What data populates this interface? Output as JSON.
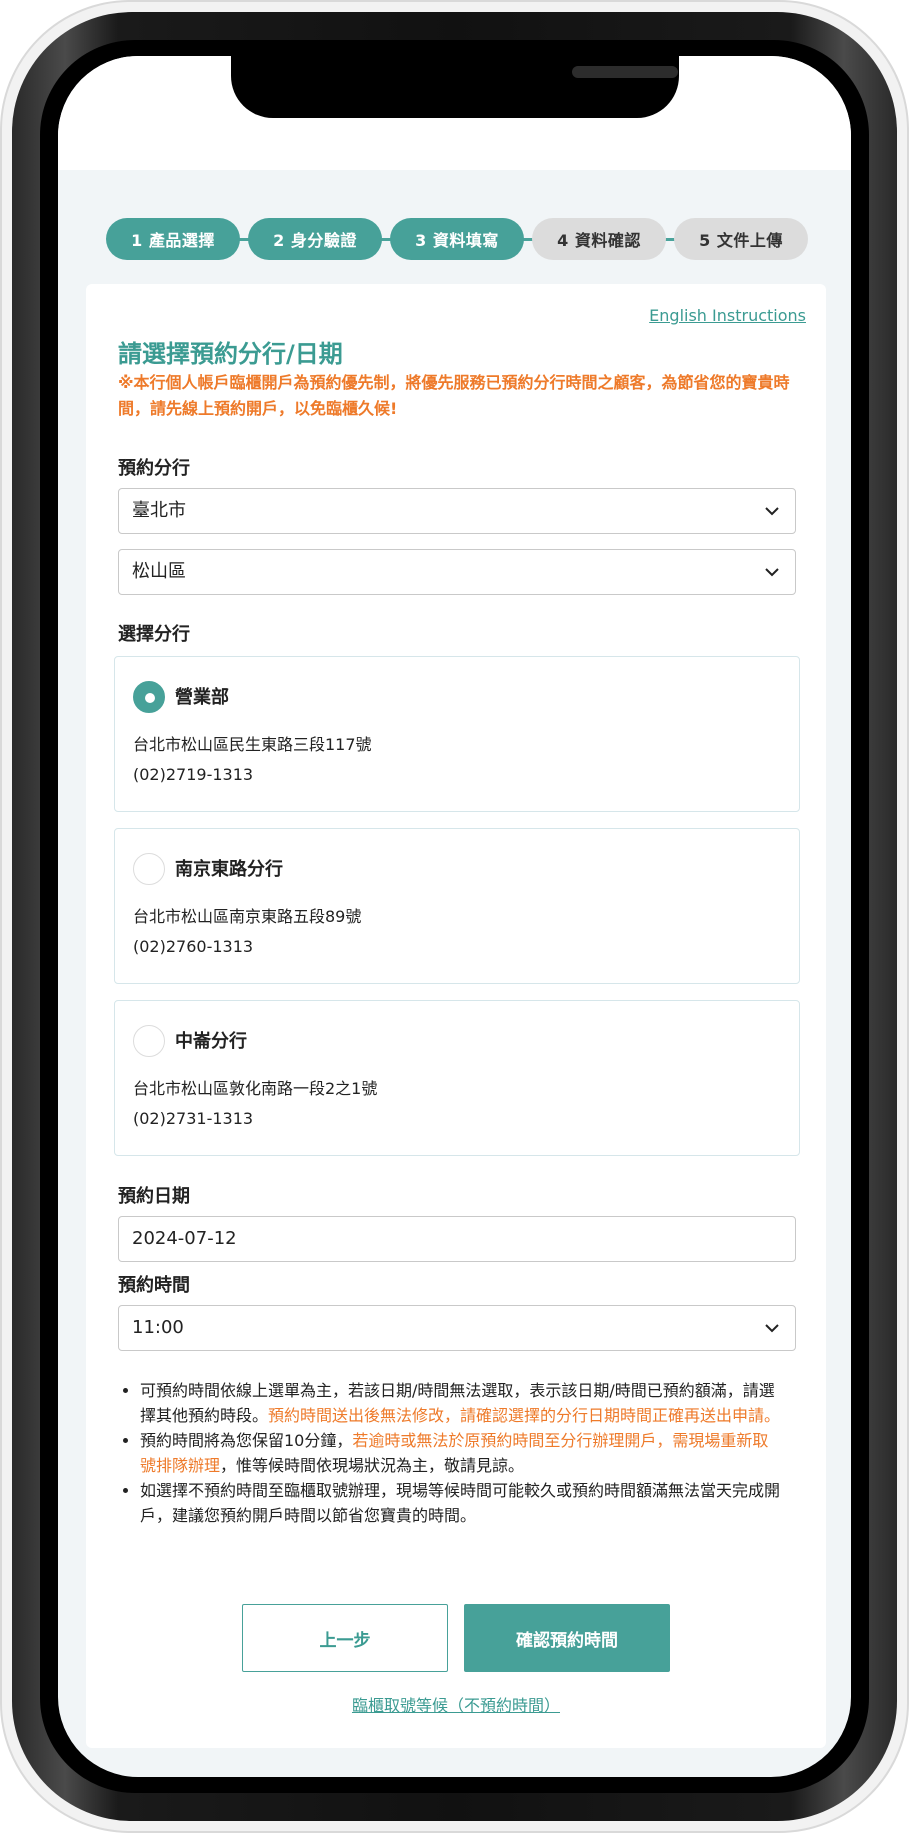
{
  "stepper": {
    "steps": [
      {
        "label": "1 產品選擇",
        "state": "done"
      },
      {
        "label": "2 身分驗證",
        "state": "done"
      },
      {
        "label": "3 資料填寫",
        "state": "active"
      },
      {
        "label": "4 資料確認",
        "state": "pending"
      },
      {
        "label": "5 文件上傳",
        "state": "pending"
      }
    ]
  },
  "card": {
    "english_link": "English Instructions",
    "title": "請選擇預約分行/日期",
    "warning": "※本行個人帳戶臨櫃開戶為預約優先制，將優先服務已預約分行時間之顧客，為節省您的寶貴時間，請先線上預約開戶，以免臨櫃久候!"
  },
  "branch_select": {
    "label": "預約分行",
    "city": "臺北市",
    "district": "松山區"
  },
  "branch_list": {
    "label": "選擇分行",
    "items": [
      {
        "name": "營業部",
        "address": "台北市松山區民生東路三段117號",
        "phone": "(02)2719-1313",
        "selected": true
      },
      {
        "name": "南京東路分行",
        "address": "台北市松山區南京東路五段89號",
        "phone": "(02)2760-1313",
        "selected": false
      },
      {
        "name": "中崙分行",
        "address": "台北市松山區敦化南路一段2之1號",
        "phone": "(02)2731-1313",
        "selected": false
      }
    ]
  },
  "date": {
    "label": "預約日期",
    "value": "2024-07-12"
  },
  "time": {
    "label": "預約時間",
    "value": "11:00"
  },
  "notes": {
    "n1_a": "可預約時間依線上選單為主，若該日期/時間無法選取，表示該日期/時間已預約額滿，請選擇其他預約時段。",
    "n1_b": "預約時間送出後無法修改，請確認選擇的分行日期時間正確再送出申請。",
    "n2_a": "預約時間將為您保留10分鐘，",
    "n2_b": "若逾時或無法於原預約時間至分行辦理開戶，需現場重新取號排隊辦理",
    "n2_c": "，惟等候時間依現場狀況為主，敬請見諒。",
    "n3": "如選擇不預約時間至臨櫃取號辦理，現場等候時間可能較久或預約時間額滿無法當天完成開戶，建議您預約開戶時間以節省您寶貴的時間。"
  },
  "buttons": {
    "prev": "上一步",
    "confirm": "確認預約時間",
    "walkin": "臨櫃取號等候（不預約時間）"
  },
  "colors": {
    "primary": "#47a199",
    "warning": "#ee7a2a",
    "inactive_step": "#dcdcdc"
  }
}
